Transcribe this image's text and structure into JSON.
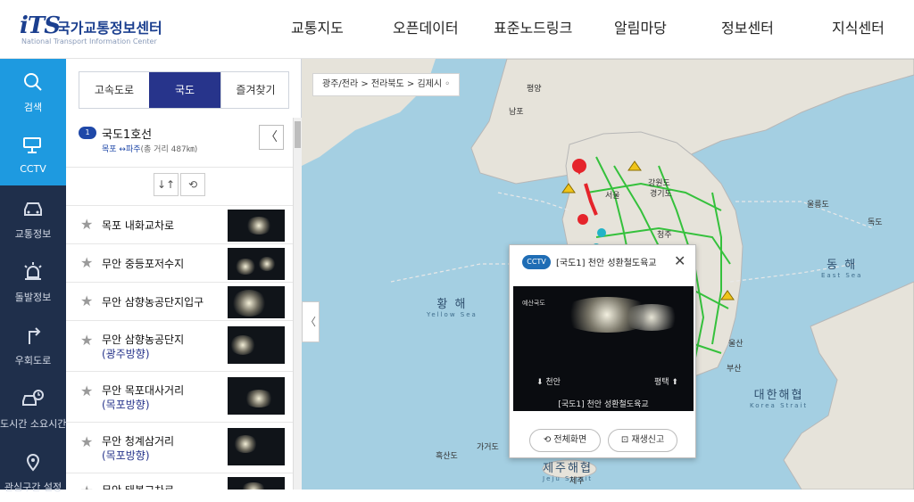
{
  "logo": {
    "mark": "iTS",
    "name_ko": "국가교통정보센터",
    "name_en": "National Transport Information Center"
  },
  "nav": [
    "교통지도",
    "오픈데이터",
    "표준노드링크",
    "알림마당",
    "정보센터",
    "지식센터"
  ],
  "rail": [
    {
      "label": "검색",
      "icon": "search-icon"
    },
    {
      "label": "CCTV",
      "icon": "cctv-icon"
    },
    {
      "label": "교통정보",
      "icon": "car-icon"
    },
    {
      "label": "돌발정보",
      "icon": "alert-icon"
    },
    {
      "label": "우회도로",
      "icon": "detour-icon"
    },
    {
      "label": "도시간 소요시간",
      "icon": "travel-time-icon"
    },
    {
      "label": "관심구간 설정",
      "icon": "pin-icon"
    }
  ],
  "panel": {
    "tabs": [
      "고속도로",
      "국도",
      "즐겨찾기"
    ],
    "route": {
      "badge": "1",
      "name": "국도1호선",
      "from_to": "목포 ↔파주",
      "distance": "(총 거리 487㎞)"
    },
    "collapse": "〈",
    "swap_icon": "↓↑",
    "refresh_icon": "⟲",
    "items": [
      {
        "name": "목포 내화교차로",
        "dir": ""
      },
      {
        "name": "무안 중등포저수지",
        "dir": ""
      },
      {
        "name": "무안 삼향농공단지입구",
        "dir": ""
      },
      {
        "name": "무안 삼향농공단지",
        "dir": "(광주방향)"
      },
      {
        "name": "무안 목포대사거리",
        "dir": "(목포방향)"
      },
      {
        "name": "무안 청계삼거리",
        "dir": "(목포방향)"
      },
      {
        "name": "무안 태봉교차로",
        "dir": ""
      }
    ]
  },
  "map": {
    "breadcrumb": "광주/전라 > 전라북도 > 김제시 ◦",
    "seas": [
      {
        "ko": "황 해",
        "en": "Yellow Sea"
      },
      {
        "ko": "동 해",
        "en": "East Sea"
      },
      {
        "ko": "대한해협",
        "en": "Korea Strait"
      },
      {
        "ko": "제주해협",
        "en": "Jeju Strait"
      }
    ],
    "cities": [
      "평양",
      "남포",
      "서울",
      "강원도",
      "경기도",
      "울릉도",
      "독도",
      "울산",
      "부산",
      "제주",
      "가거도",
      "가거도",
      "흑산도",
      "청주"
    ],
    "collapse": "〈"
  },
  "popup": {
    "badge": "CCTV",
    "title": "[국도1] 천안 성환철도육교",
    "close": "✕",
    "video_top": "예산국도",
    "video_left": "⬇ 천안",
    "video_right": "평택 ⬆",
    "video_caption": "[국도1] 천안 성환철도육교",
    "fullscreen": "⟲ 전체화면",
    "report": "⊡ 재생신고"
  },
  "colors": {
    "brand": "#27348b",
    "rail": "#1f2f4b",
    "active": "#1e9ae0",
    "sea": "#a4cfe2",
    "land": "#e6e3da",
    "traffic": "#35c13c"
  }
}
